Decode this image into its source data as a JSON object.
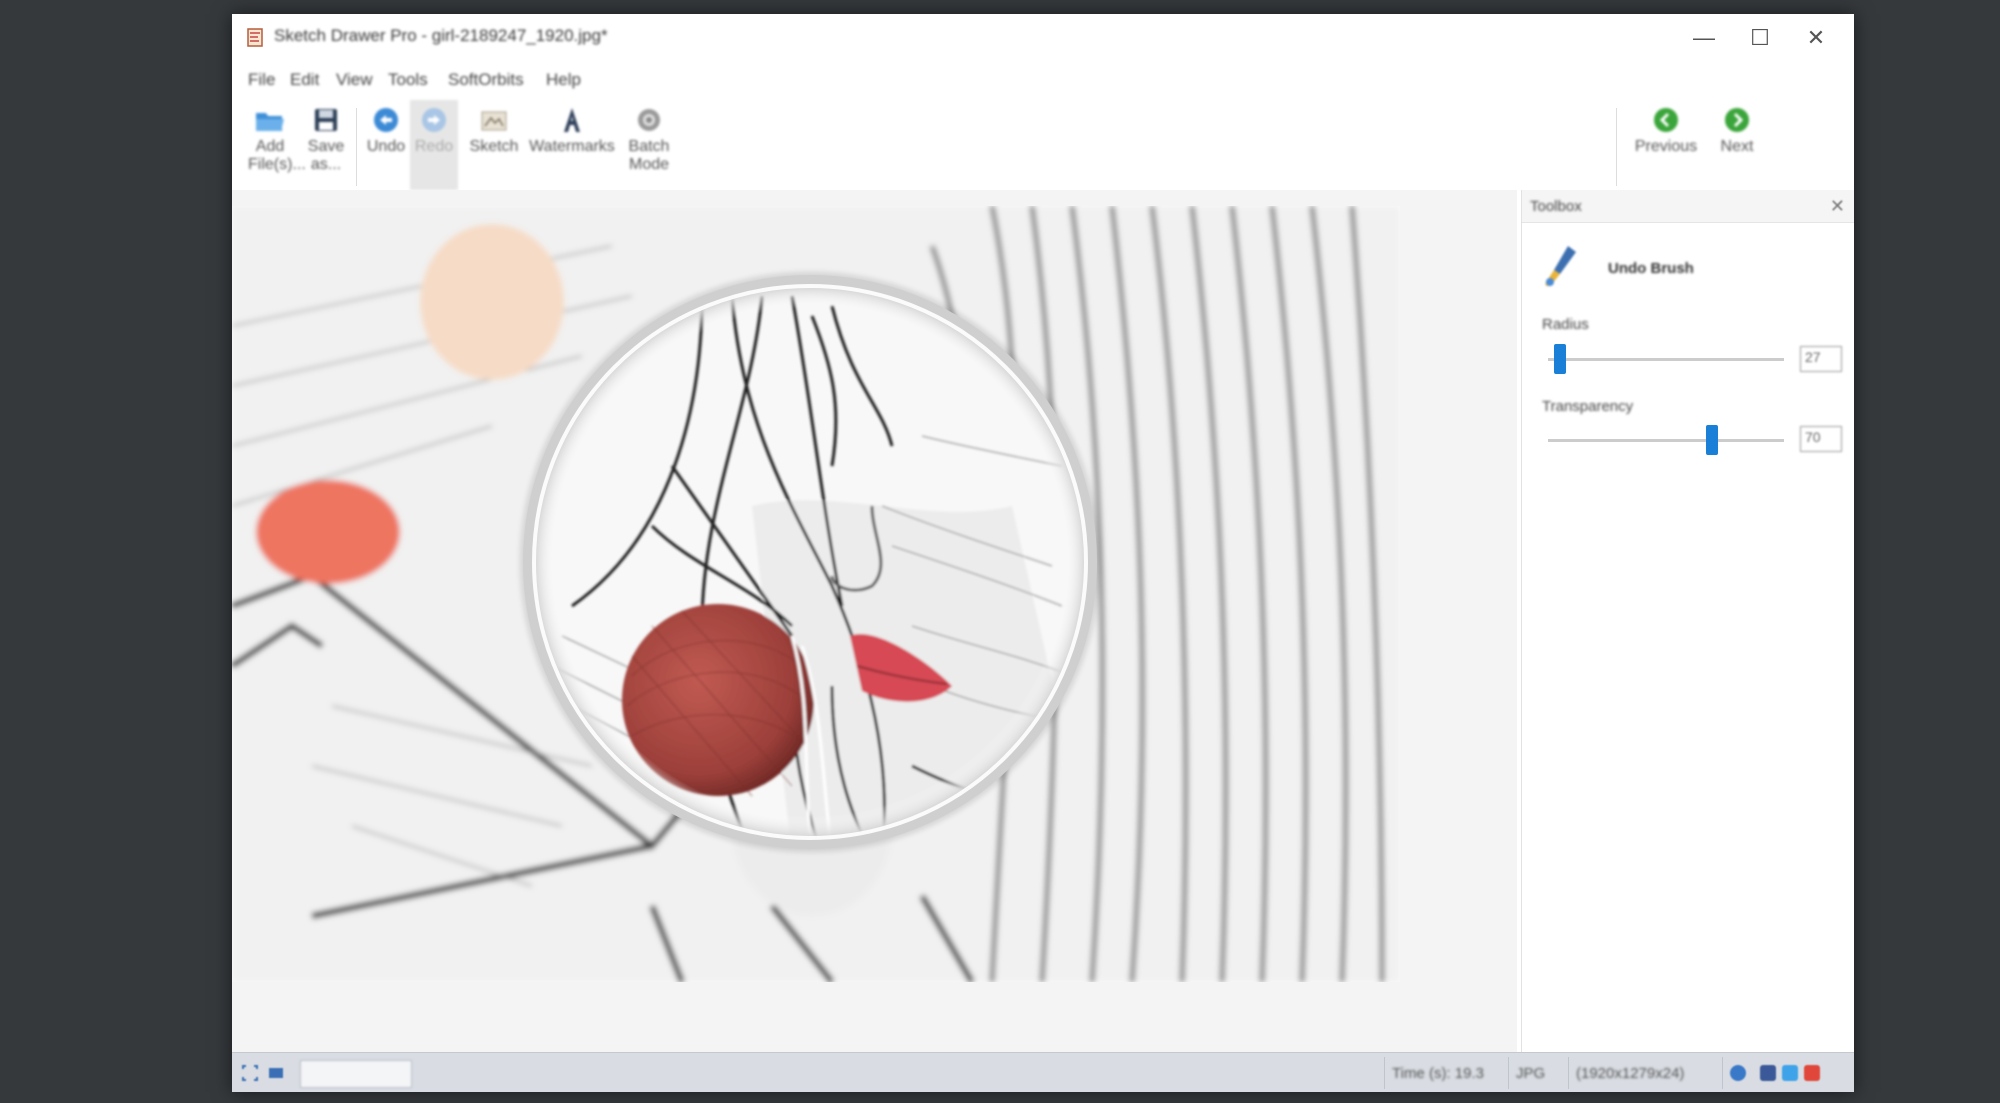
{
  "window": {
    "title": "Sketch Drawer Pro - girl-2189247_1920.jpg*",
    "controls": {
      "minimize": "—",
      "maximize": "☐",
      "close": "✕"
    }
  },
  "menu": [
    "File",
    "Edit",
    "View",
    "Tools",
    "SoftOrbits",
    "Help"
  ],
  "toolbar": {
    "buttons": [
      {
        "label": "Add\nFile(s)...",
        "icon": "folder-open-icon",
        "enabled": true
      },
      {
        "label": "Save\nas...",
        "icon": "save-icon",
        "enabled": true
      },
      {
        "label": "Undo",
        "icon": "undo-icon",
        "enabled": true
      },
      {
        "label": "Redo",
        "icon": "redo-icon",
        "enabled": false
      },
      {
        "label": "Sketch",
        "icon": "sketch-icon",
        "enabled": true
      },
      {
        "label": "Watermarks",
        "icon": "watermark-icon",
        "enabled": true
      },
      {
        "label": "Batch\nMode",
        "icon": "gear-icon",
        "enabled": true
      }
    ],
    "nav": [
      {
        "label": "Previous",
        "icon": "previous-icon"
      },
      {
        "label": "Next",
        "icon": "next-icon"
      }
    ]
  },
  "toolbox": {
    "title": "Toolbox",
    "close_icon": "✕",
    "tool_name": "Undo Brush",
    "radius": {
      "label": "Radius",
      "value": "27",
      "fraction": 0.05
    },
    "transparency": {
      "label": "Transparency",
      "value": "70",
      "fraction": 0.7
    }
  },
  "statusbar": {
    "time": "Time (s): 19.3",
    "format": "JPG",
    "dimensions": "(1920x1279x24)"
  },
  "colors": {
    "accent": "#1a7fd6",
    "nav_green": "#3aa53a",
    "lip_red": "#d64a55",
    "yarn_red": "#9c3f3a"
  }
}
